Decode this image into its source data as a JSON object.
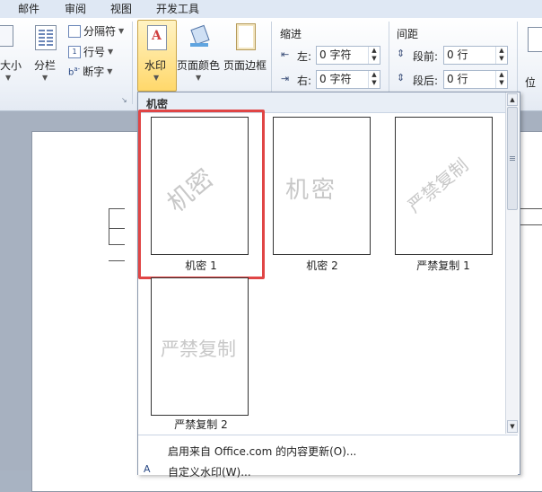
{
  "tabs": [
    "邮件",
    "审阅",
    "视图",
    "开发工具"
  ],
  "ribbon": {
    "size_label": "大小",
    "columns_label": "分栏",
    "breaks_label": "分隔符",
    "line_numbers_label": "行号",
    "hyphenation_label": "断字",
    "watermark_label": "水印",
    "page_color_label": "页面颜色",
    "page_border_label": "页面边框",
    "indent": {
      "title": "缩进",
      "left_label": "左:",
      "left_value": "0 字符",
      "right_label": "右:",
      "right_value": "0 字符"
    },
    "spacing": {
      "title": "间距",
      "before_label": "段前:",
      "before_value": "0 行",
      "after_label": "段后:",
      "after_value": "0 行"
    },
    "position_label": "位"
  },
  "gallery": {
    "section_title": "机密",
    "items": [
      {
        "caption": "机密 1",
        "watermark": "机密",
        "style": "diagonal"
      },
      {
        "caption": "机密 2",
        "watermark": "机密",
        "style": "horizontal"
      },
      {
        "caption": "严禁复制 1",
        "watermark": "严禁复制",
        "style": "diagonal"
      },
      {
        "caption": "严禁复制 2",
        "watermark": "严禁复制",
        "style": "horizontal"
      }
    ],
    "menu": [
      {
        "label": "启用来自 Office.com 的内容更新(O)..."
      },
      {
        "label": "自定义水印(W)..."
      }
    ]
  },
  "colors": {
    "highlight": "#e04545",
    "watermark_text": "#c8c8c8"
  }
}
